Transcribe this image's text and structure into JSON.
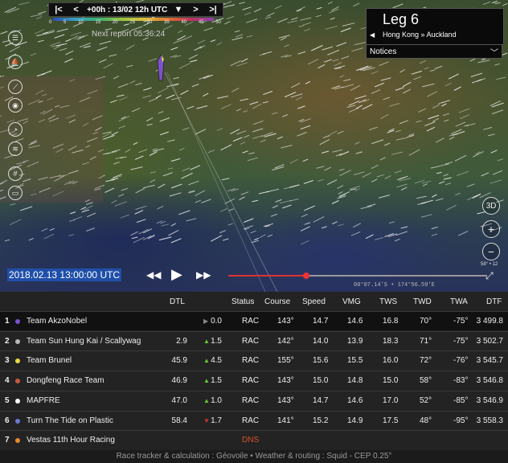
{
  "toolbar": {
    "time_label": "+00h : 13/02 12h UTC"
  },
  "colorbar": {
    "ticks": [
      "0",
      "5",
      "10",
      "15",
      "20",
      "25",
      "30",
      "35",
      "40",
      "45",
      "50"
    ]
  },
  "next_report": "Next report 05:36:24",
  "leg": {
    "title": "Leg 6",
    "route": "Hong Kong » Auckland"
  },
  "notices": {
    "label": "Notices"
  },
  "left_tools": [
    "team-list-icon",
    "ghost-boat-icon",
    "route-icon",
    "zoom-boat-icon",
    "wind-gauge-icon",
    "wind-layer-icon",
    "grid-icon",
    "boat-icon"
  ],
  "right_tools": {
    "view3d_label": "3D"
  },
  "playback": {
    "date": "2018.02.13 13:00:00 UTC",
    "progress": 0.3
  },
  "coords": "00°07.14'S • 174°56.59'E",
  "scale_partial": "58° • 12",
  "table": {
    "headers": {
      "dtl": "DTL",
      "status": "Status",
      "course": "Course",
      "speed": "Speed",
      "vmg": "VMG",
      "tws": "TWS",
      "twd": "TWD",
      "twa": "TWA",
      "dtf": "DTF"
    },
    "rows": [
      {
        "rank": "1",
        "color": "#7b52c8",
        "team": "Team AkzoNobel",
        "dtl": "",
        "trend": "same",
        "delta": "0.0",
        "status": "RAC",
        "course": "143°",
        "speed": "14.7",
        "vmg": "14.6",
        "tws": "16.8",
        "twd": "70°",
        "twa": "-75°",
        "dtf": "3 499.8"
      },
      {
        "rank": "2",
        "color": "#b8b8b8",
        "team": "Team Sun Hung Kai / Scallywag",
        "dtl": "2.9",
        "trend": "up",
        "delta": "1.5",
        "status": "RAC",
        "course": "142°",
        "speed": "14.0",
        "vmg": "13.9",
        "tws": "18.3",
        "twd": "71°",
        "twa": "-75°",
        "dtf": "3 502.7"
      },
      {
        "rank": "3",
        "color": "#e8d840",
        "team": "Team Brunel",
        "dtl": "45.9",
        "trend": "up",
        "delta": "4.5",
        "status": "RAC",
        "course": "155°",
        "speed": "15.6",
        "vmg": "15.5",
        "tws": "16.0",
        "twd": "72°",
        "twa": "-76°",
        "dtf": "3 545.7"
      },
      {
        "rank": "4",
        "color": "#c85a3c",
        "team": "Dongfeng Race Team",
        "dtl": "46.9",
        "trend": "up",
        "delta": "1.5",
        "status": "RAC",
        "course": "143°",
        "speed": "15.0",
        "vmg": "14.8",
        "tws": "15.0",
        "twd": "58°",
        "twa": "-83°",
        "dtf": "3 546.8"
      },
      {
        "rank": "5",
        "color": "#ffffff",
        "team": "MAPFRE",
        "dtl": "47.0",
        "trend": "up",
        "delta": "1.0",
        "status": "RAC",
        "course": "143°",
        "speed": "14.7",
        "vmg": "14.6",
        "tws": "17.0",
        "twd": "52°",
        "twa": "-85°",
        "dtf": "3 546.9"
      },
      {
        "rank": "6",
        "color": "#6a7ad0",
        "team": "Turn The Tide on Plastic",
        "dtl": "58.4",
        "trend": "down",
        "delta": "1.7",
        "status": "RAC",
        "course": "141°",
        "speed": "15.2",
        "vmg": "14.9",
        "tws": "17.5",
        "twd": "48°",
        "twa": "-95°",
        "dtf": "3 558.3"
      },
      {
        "rank": "7",
        "color": "#e88a30",
        "team": "Vestas 11th Hour Racing",
        "dtl": "",
        "trend": "",
        "delta": "",
        "status": "DNS",
        "course": "",
        "speed": "",
        "vmg": "",
        "tws": "",
        "twd": "",
        "twa": "",
        "dtf": ""
      }
    ]
  },
  "footer": "Race tracker & calculation : Géovoile • Weather & routing : Squid - CEP 0.25°"
}
